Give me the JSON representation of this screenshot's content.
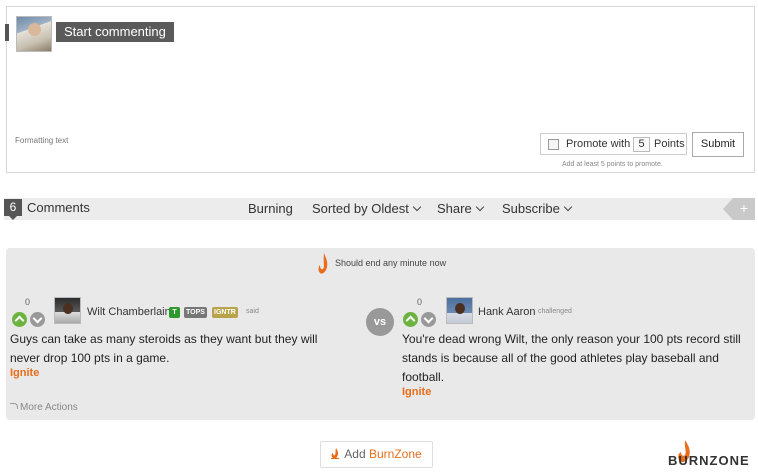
{
  "composer": {
    "prompt": "Start commenting",
    "formatting_text": "Formatting text",
    "promote_label": "Promote with",
    "promote_points": "5",
    "points_label": "Points",
    "submit_label": "Submit",
    "promote_hint": "Add at least 5 points to promote.",
    "promote_checked": false
  },
  "comments_bar": {
    "count": "6",
    "label": "Comments",
    "burning": "Burning",
    "sort": "Sorted by Oldest",
    "share": "Share",
    "subscribe": "Subscribe",
    "plus": "+"
  },
  "debate": {
    "headline": "Should end any minute now",
    "vs": "vs",
    "more_actions": "More Actions",
    "left": {
      "votes": "0",
      "author": "Wilt Chamberlain",
      "badges": [
        "T",
        "TOPS",
        "IGNTR"
      ],
      "verb": "said",
      "text": "Guys can take as many steroids as they want but they will never drop 100 pts in a game.",
      "ignite": "Ignite"
    },
    "right": {
      "votes": "0",
      "author": "Hank Aaron",
      "verb": "challenged",
      "text": "You're dead wrong Wilt, the only reason your 100 pts record still stands is because all of the good athletes play baseball and football.",
      "ignite": "Ignite"
    }
  },
  "footer": {
    "add_prefix": "Add ",
    "add_brand": "BurnZone",
    "logo_text": "BURNZONE"
  },
  "colors": {
    "accent": "#e86d1c",
    "vote_up": "#6db33f",
    "bar_bg": "#ececec",
    "card_bg": "#e9e9e9"
  }
}
